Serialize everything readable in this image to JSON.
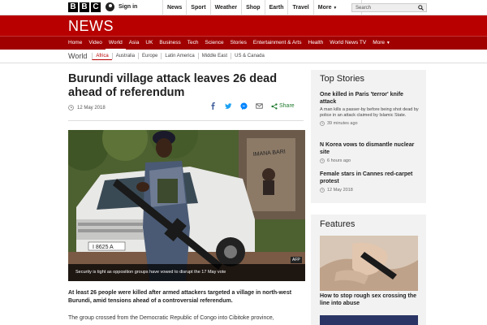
{
  "masthead": {
    "logo_letters": [
      "B",
      "B",
      "C"
    ],
    "signin_label": "Sign in",
    "nav": [
      "News",
      "Sport",
      "Weather",
      "Shop",
      "Earth",
      "Travel",
      "More"
    ],
    "more_chevron": "chevron-down-icon",
    "search_placeholder": "Search"
  },
  "header": {
    "title": "NEWS",
    "brand_color": "#b80000",
    "nav": [
      "Home",
      "Video",
      "World",
      "Asia",
      "UK",
      "Business",
      "Tech",
      "Science",
      "Stories",
      "Entertainment & Arts",
      "Health",
      "World News TV",
      "More"
    ],
    "active_nav": "World"
  },
  "subnav": {
    "title": "World",
    "items": [
      "Africa",
      "Australia",
      "Europe",
      "Latin America",
      "Middle East",
      "US & Canada"
    ],
    "active": "Africa"
  },
  "article": {
    "headline": "Burundi village attack leaves 26 dead ahead of referendum",
    "date": "12 May 2018",
    "share_label": "Share",
    "share_icons": [
      "facebook-icon",
      "twitter-icon",
      "messenger-icon",
      "email-icon",
      "share-icon"
    ],
    "image_caption": "Security is tight as opposition groups have vowed to disrupt the 17 May vote",
    "image_credit": "AFP",
    "plate_text": "I 8625 A",
    "intro": "At least 26 people were killed after armed attackers targeted a village in north-west Burundi, amid tensions ahead of a controversial referendum.",
    "para2": "The group crossed from the Democratic Republic of Congo into Cibitoke province,"
  },
  "top_stories": {
    "title": "Top Stories",
    "items": [
      {
        "headline": "One killed in Paris 'terror' knife attack",
        "summary": "A man kills a passer-by before being shot dead by police in an attack claimed by Islamic State.",
        "time": "39 minutes ago"
      },
      {
        "headline": "N Korea vows to dismantle nuclear site",
        "summary": "",
        "time": "6 hours ago"
      },
      {
        "headline": "Female stars in Cannes red-carpet protest",
        "summary": "",
        "time": "12 May 2018"
      }
    ]
  },
  "features": {
    "title": "Features",
    "item_title": "How to stop rough sex crossing the line into abuse"
  }
}
